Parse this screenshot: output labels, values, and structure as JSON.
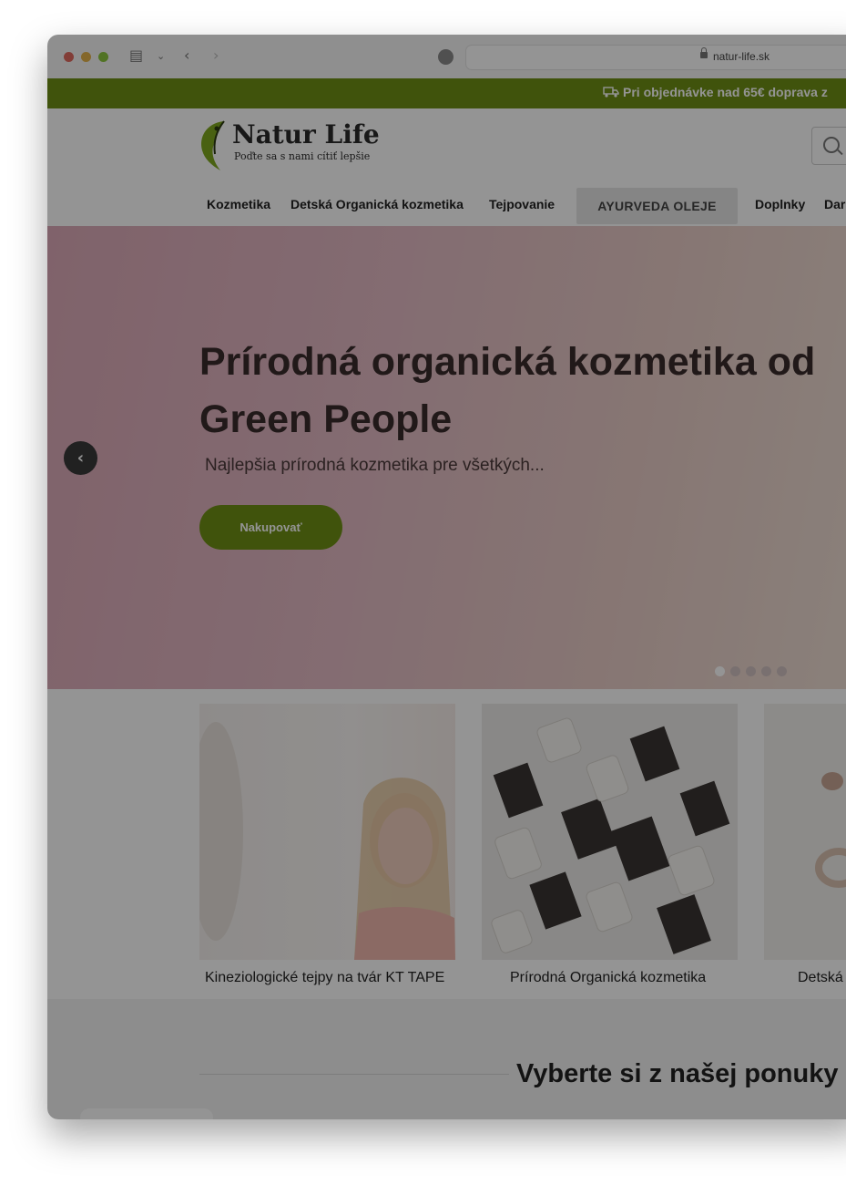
{
  "browser": {
    "url": "natur-life.sk"
  },
  "promo_bar": {
    "text": "Pri objednávke nad 65€ doprava z"
  },
  "logo": {
    "title": "Natur Life",
    "tagline": "Poďte sa s nami cítiť lepšie"
  },
  "nav": {
    "items": [
      "Kozmetika",
      "Detská Organická kozmetika",
      "Tejpovanie",
      "AYURVEDA OLEJE",
      "Doplnky",
      "Dar"
    ]
  },
  "hero": {
    "title": "Prírodná organická kozmetika od Green People",
    "subtitle": "Najlepšia prírodná kozmetika pre všetkých...",
    "button": "Nakupovať",
    "slides_total": 5,
    "active_slide": 1
  },
  "categories": [
    {
      "label": "Kineziologické tejpy na tvár KT TAPE"
    },
    {
      "label": "Prírodná Organická kozmetika"
    },
    {
      "label": "Detská"
    }
  ],
  "section": {
    "title": "Vyberte si z našej ponuky"
  },
  "colors": {
    "brand_green": "#6e9015",
    "hero_pink": "#dcaab8"
  }
}
